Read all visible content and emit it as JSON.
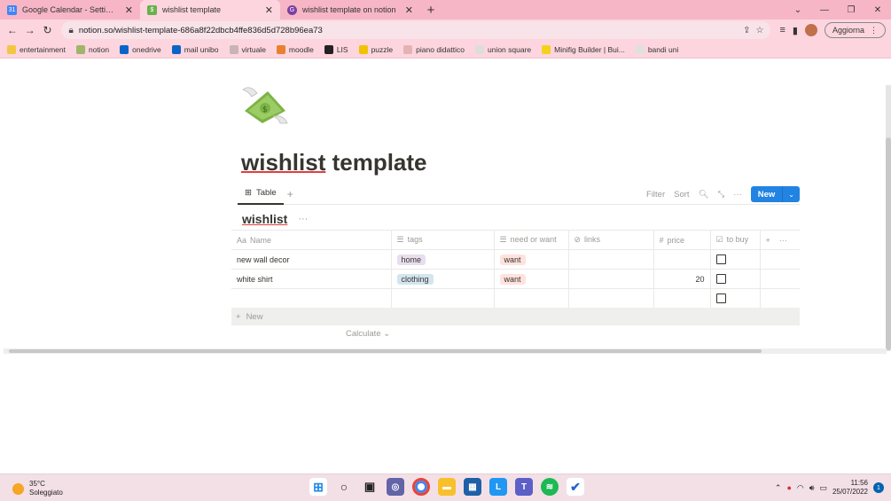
{
  "browser": {
    "tabs": [
      {
        "title": "Google Calendar - Settimana del",
        "icon": "calendar-icon",
        "active": false
      },
      {
        "title": "wishlist template",
        "icon": "money-icon",
        "active": true
      },
      {
        "title": "wishlist template on notion",
        "icon": "notion-circle-icon",
        "active": false
      }
    ],
    "url": "notion.so/wishlist-template-686a8f22dbcb4ffe836d5d728b96ea73",
    "update_label": "Aggiorna",
    "bookmarks": [
      {
        "label": "entertainment",
        "icon": "folder-icon",
        "color": "#f4c542"
      },
      {
        "label": "notion",
        "icon": "notion-house-icon",
        "color": "#9fb56a"
      },
      {
        "label": "onedrive",
        "icon": "cloud-icon",
        "color": "#0a64c8"
      },
      {
        "label": "mail unibo",
        "icon": "outlook-icon",
        "color": "#0a64c8"
      },
      {
        "label": "virtuale",
        "icon": "virtuale-icon",
        "color": "#c8b4b4"
      },
      {
        "label": "moodle",
        "icon": "moodle-icon",
        "color": "#e8812f"
      },
      {
        "label": "LIS",
        "icon": "lis-icon",
        "color": "#222222"
      },
      {
        "label": "puzzle",
        "icon": "puzzle-icon",
        "color": "#f2c200"
      },
      {
        "label": "piano didattico",
        "icon": "piano-icon",
        "color": "#e3b3b3"
      },
      {
        "label": "union square",
        "icon": "union-square-icon",
        "color": "#dddddd"
      },
      {
        "label": "Minifig Builder | Bui...",
        "icon": "minifig-icon",
        "color": "#f3d21a"
      },
      {
        "label": "bandi uni",
        "icon": "bandi-icon",
        "color": "#e0e0e0"
      }
    ]
  },
  "page": {
    "title_part1": "wishlist",
    "title_part2": " template",
    "view_tab": "Table",
    "actions": {
      "filter": "Filter",
      "sort": "Sort",
      "new": "New"
    },
    "db_title": "wishlist",
    "columns": [
      {
        "label": "Name",
        "icon": "text-icon"
      },
      {
        "label": "tags",
        "icon": "list-icon"
      },
      {
        "label": "need or want",
        "icon": "list-icon"
      },
      {
        "label": "links",
        "icon": "link-icon"
      },
      {
        "label": "price",
        "icon": "hash-icon"
      },
      {
        "label": "to buy",
        "icon": "checkbox-icon"
      }
    ],
    "rows": [
      {
        "name": "new wall decor",
        "tag": "home",
        "need": "want",
        "links": "",
        "price": "",
        "to_buy": false
      },
      {
        "name": "white shirt",
        "tag": "clothing",
        "need": "want",
        "links": "",
        "price": "20",
        "to_buy": false
      },
      {
        "name": "",
        "tag": "",
        "need": "",
        "links": "",
        "price": "",
        "to_buy": false
      }
    ],
    "tag_colors": {
      "home": "#e8deee",
      "clothing": "#d3e5ef",
      "want": "#ffe2dd"
    },
    "new_row_label": "New",
    "calculate_label": "Calculate"
  },
  "taskbar": {
    "temperature": "35°C",
    "weather": "Soleggiato",
    "time": "11:56",
    "date": "25/07/2022",
    "notifications": "1"
  }
}
